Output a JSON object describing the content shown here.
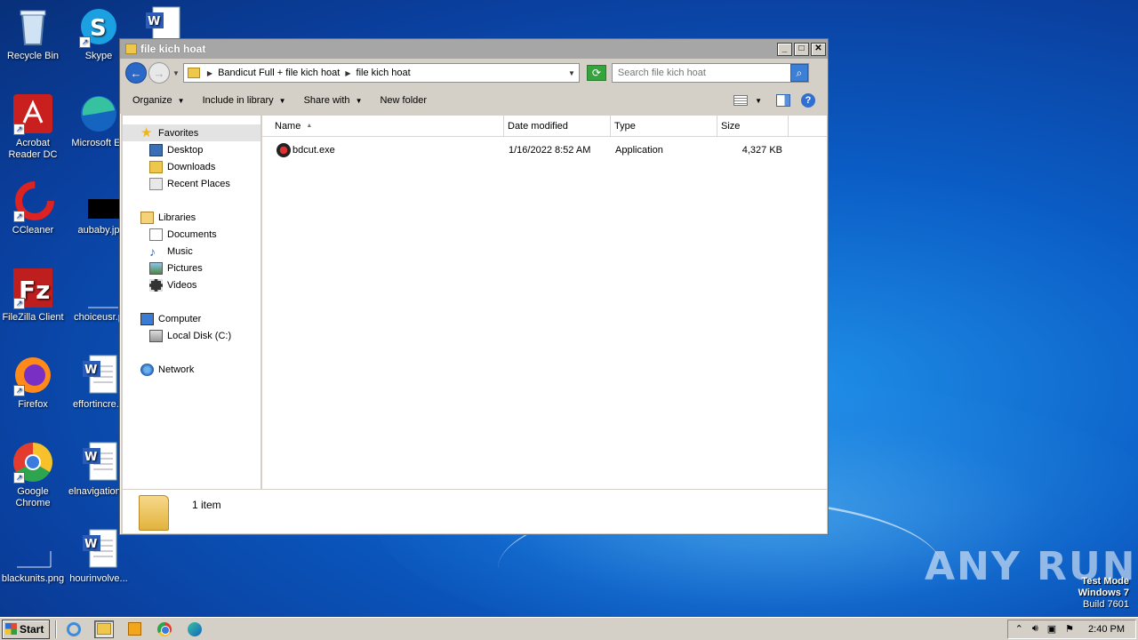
{
  "desktop": {
    "icons": [
      {
        "label": "Recycle Bin",
        "icon": "recycle-bin-icon"
      },
      {
        "label": "Skype",
        "icon": "skype-icon"
      },
      {
        "label": "Acrobat Reader DC",
        "icon": "acrobat-icon"
      },
      {
        "label": "Microsoft Edge",
        "icon": "edge-icon"
      },
      {
        "label": "CCleaner",
        "icon": "ccleaner-icon"
      },
      {
        "label": "aubaby.jpg",
        "icon": "image-file-icon"
      },
      {
        "label": "FileZilla Client",
        "icon": "filezilla-icon"
      },
      {
        "label": "choiceusr.png",
        "icon": "image-file-icon"
      },
      {
        "label": "Firefox",
        "icon": "firefox-icon"
      },
      {
        "label": "effortincre...",
        "icon": "word-doc-icon"
      },
      {
        "label": "Google Chrome",
        "icon": "chrome-icon"
      },
      {
        "label": "elnavigation...",
        "icon": "word-doc-icon"
      },
      {
        "label": "blackunits.png",
        "icon": "image-file-icon"
      },
      {
        "label": "hourinvolve...",
        "icon": "word-doc-icon"
      }
    ],
    "label_acrobat_1": "Acrobat",
    "label_acrobat_2": "Reader DC",
    "label_edge": "Microsoft Ed",
    "label_chrome_1": "Google",
    "label_chrome_2": "Chrome",
    "label_effort": "effortincre...",
    "label_elnav": "elnavigation...",
    "label_choice": "choiceusr.p",
    "label_aubaby": "aubaby.jp"
  },
  "window": {
    "title": "file kich hoat",
    "breadcrumb": [
      "Bandicut Full + file kich hoat",
      "file kich hoat"
    ],
    "search_placeholder": "Search file kich hoat",
    "toolbar": {
      "organize": "Organize",
      "include_in_library": "Include in library",
      "share_with": "Share with",
      "new_folder": "New folder"
    },
    "nav": {
      "favorites": "Favorites",
      "desktop": "Desktop",
      "downloads": "Downloads",
      "recent_places": "Recent Places",
      "libraries": "Libraries",
      "documents": "Documents",
      "music": "Music",
      "pictures": "Pictures",
      "videos": "Videos",
      "computer": "Computer",
      "local_disk": "Local Disk (C:)",
      "network": "Network"
    },
    "columns": {
      "name": "Name",
      "date_modified": "Date modified",
      "type": "Type",
      "size": "Size"
    },
    "files": [
      {
        "name": "bdcut.exe",
        "date_modified": "1/16/2022 8:52 AM",
        "type": "Application",
        "size": "4,327 KB"
      }
    ],
    "status": "1 item"
  },
  "taskbar": {
    "start_label": "Start",
    "clock": "2:40 PM"
  },
  "watermark": {
    "line1": "Test Mode",
    "line2": "Windows 7",
    "line3": "Build 7601",
    "brand": "ANY RUN"
  }
}
